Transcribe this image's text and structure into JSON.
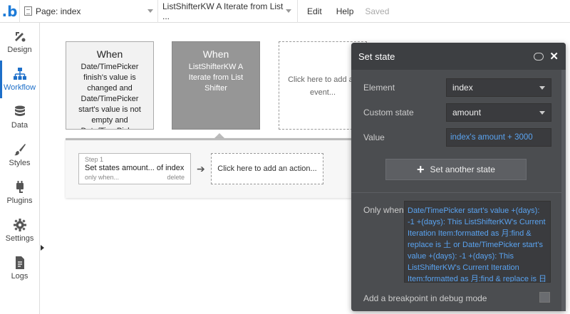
{
  "topbar": {
    "logo": ".b",
    "page_label": "Page: index",
    "element_label": "ListShifterKW A Iterate from List ...",
    "menu": [
      "Edit",
      "Help"
    ],
    "saved": "Saved"
  },
  "sidebar": {
    "items": [
      {
        "label": "Design",
        "icon": "design-icon"
      },
      {
        "label": "Workflow",
        "icon": "workflow-icon",
        "active": true
      },
      {
        "label": "Data",
        "icon": "database-icon"
      },
      {
        "label": "Styles",
        "icon": "brush-icon"
      },
      {
        "label": "Plugins",
        "icon": "plug-icon"
      },
      {
        "label": "Settings",
        "icon": "gear-icon"
      },
      {
        "label": "Logs",
        "icon": "document-icon"
      }
    ]
  },
  "events": [
    {
      "when": "When",
      "desc": "Date/TimePicker finish's value is changed and Date/TimePicker start's value is not empty and Date/TimePicker"
    },
    {
      "when": "When",
      "desc": "ListShifterKW A Iterate from List Shifter"
    },
    {
      "desc": "Click here to add an event..."
    }
  ],
  "action": {
    "step_num": "Step 1",
    "step_title": "Set states amount... of index",
    "only_when": "only when...",
    "delete": "delete",
    "add_action": "Click here to add an action..."
  },
  "dialog": {
    "title": "Set state",
    "element_label": "Element",
    "element_value": "index",
    "custom_state_label": "Custom state",
    "custom_state_value": "amount",
    "value_label": "Value",
    "value_expr": "index's amount + 3000",
    "set_another": "Set another state",
    "only_when_label": "Only when",
    "only_when_expr": "Date/TimePicker start's value +(days): -1 +(days): This ListShifterKW's Current Iteration Item:formatted as 月:find & replace is 土 or Date/TimePicker start's value +(days): -1 +(days): This ListShifterKW's Current Iteration Item:formatted as 月:find & replace is 日",
    "breakpoint_label": "Add a breakpoint in debug mode"
  },
  "colors": {
    "accent": "#1d6fc9",
    "dialog_bg": "#4b4d50",
    "expression_blue": "#5aa3f0"
  }
}
